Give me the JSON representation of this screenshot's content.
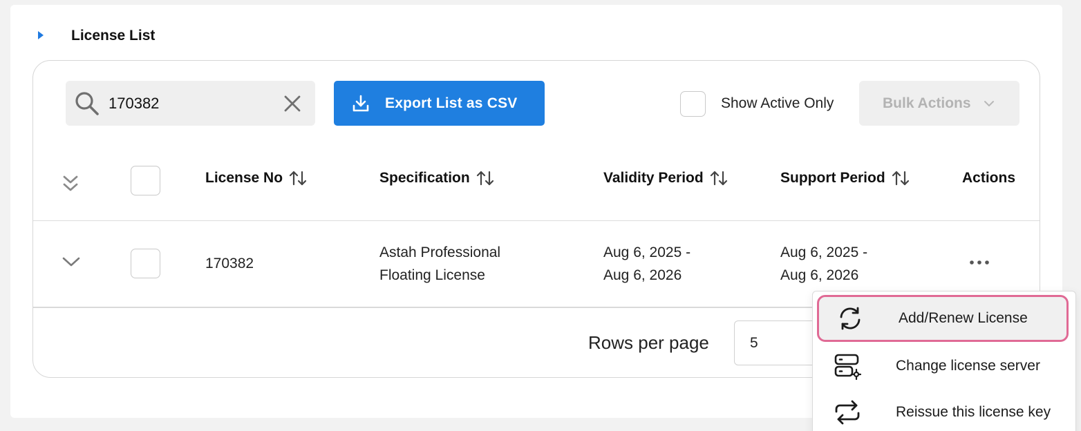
{
  "section": {
    "title": "License List"
  },
  "search": {
    "value": "170382"
  },
  "toolbar": {
    "export_label": "Export List as CSV",
    "show_active_label": "Show Active Only",
    "bulk_actions_label": "Bulk Actions"
  },
  "table": {
    "headers": [
      "License No",
      "Specification",
      "Validity Period",
      "Support Period",
      "Actions"
    ],
    "rows": [
      {
        "license_no": "170382",
        "specification_line1": "Astah Professional",
        "specification_line2": "Floating License",
        "validity_line1": "Aug 6, 2025 -",
        "validity_line2": "Aug 6, 2026",
        "support_line1": "Aug 6, 2025 -",
        "support_line2": "Aug 6, 2026"
      }
    ]
  },
  "pagination": {
    "rows_per_page_label": "Rows per page",
    "rows_per_page_value": "5"
  },
  "actions_menu": {
    "items": [
      {
        "label": "Add/Renew License",
        "icon": "refresh-icon"
      },
      {
        "label": "Change license server",
        "icon": "server-settings-icon"
      },
      {
        "label": "Reissue this license key",
        "icon": "repeat-icon"
      }
    ]
  },
  "colors": {
    "primary": "#1f7fe0",
    "highlight_border": "#e06a95",
    "caret": "#1f7ae0"
  }
}
